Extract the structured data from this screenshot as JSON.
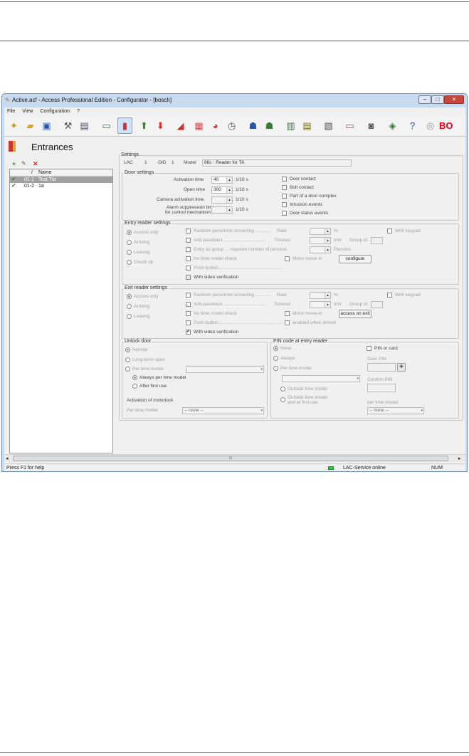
{
  "window": {
    "title": "Active.acf - Access Professional Edition - Configurator - [bosch]",
    "minimize": "–",
    "maximize": "□",
    "close": "✕"
  },
  "menu": [
    "File",
    "View",
    "Configuration",
    "?"
  ],
  "toolbar": {
    "icons": [
      "new-wizard-icon",
      "open-folder-icon",
      "save-icon",
      "device-tools-icon",
      "controllers-icon",
      "card-reader-icon",
      "entrances-icon",
      "import-icon",
      "export-icon",
      "areas-icon",
      "calendar-icon",
      "time-models-icon",
      "day-models-icon",
      "persons-icon",
      "groups-icon",
      "authorizations-icon",
      "authorizations-list-icon",
      "reports-icon",
      "card-icon",
      "video-icon",
      "map-icon",
      "help-icon",
      "bosch-logo"
    ],
    "brand": "BO"
  },
  "page": {
    "title": "Entrances"
  },
  "left_list": {
    "col_sort": "/",
    "col_name": "Name",
    "rows": [
      {
        "id": "01-1",
        "name": "Test Tür",
        "selected": true
      },
      {
        "id": "01-2",
        "name": "1a",
        "selected": false
      }
    ]
  },
  "settings": {
    "label": "Settings",
    "lac_label": "LAC",
    "lac_value": "1",
    "gid_label": "GID",
    "gid_value": "1",
    "model_label": "Model",
    "model_value": "86c - Reader for TA"
  },
  "door_settings": {
    "label": "Door settings",
    "activation_time_label": "Activation time",
    "activation_time_value": "40",
    "activation_time_unit": "1/10 s",
    "open_time_label": "Open time",
    "open_time_value": "300",
    "open_time_unit": "1/10 s",
    "camera_label": "Camera activation time",
    "camera_unit": "1/10 s",
    "alarm_label_1": "Alarm suppression time",
    "alarm_label_2": "for control mechanism",
    "alarm_unit": "1/10 s",
    "checks": [
      "Door contact",
      "Bolt contact",
      "Part of a door-complex",
      "Intrusion events",
      "Door status events"
    ]
  },
  "entry_reader": {
    "label": "Entry reader settings",
    "radios": [
      "Access only",
      "Arriving",
      "Leaving",
      "Check ok"
    ],
    "random": "Random personnel screening ............",
    "rate_label": "Rate",
    "rate_unit": "%",
    "with_keypad": "With keypad",
    "antipassback": "Anti-passback ................................",
    "timeout_label": "Timeout",
    "timeout_unit": "min.",
    "group_id_label": "Group id",
    "entry_group": "Entry as group ... required number of persons",
    "persons_label": "Persons",
    "no_time_model": "No time model check",
    "motor_move_in": "Motor move-in",
    "configure_btn": "configure",
    "push_button": "Push button..................................................",
    "video_verification": "With video verification"
  },
  "exit_reader": {
    "label": "Exit reader settings",
    "radios": [
      "Access only",
      "Arriving",
      "Leaving"
    ],
    "random": "Random personnel screening ............",
    "rate_label": "Rate",
    "rate_unit": "%",
    "with_keypad": "With keypad",
    "antipassback": "Anti-passback ................................",
    "timeout_label": "Timeout",
    "timeout_unit": "min.",
    "group_id_label": "Group id",
    "no_time_model": "No time model check",
    "motor_move_in": "Motor move-in",
    "access_on_exit_btn": "access on exit",
    "push_button": "Push button..................................................",
    "enabled_when_armed": "enabled when armed",
    "video_verification": "With video verification"
  },
  "unlock_door": {
    "label": "Unlock door",
    "normal": "Normal",
    "long_term": "Long-term open",
    "per_time_model": "Per time model",
    "always": "Always per time model",
    "after_first_use": "After first use",
    "motorlock_label": "Activation of motorlock",
    "per_time_model_label": "Per time model",
    "motorlock_value": "-- none --"
  },
  "pin_code": {
    "label": "PIN code at entry reader",
    "none": "None",
    "always": "Always",
    "per_time_model": "Per time model",
    "outside": "Outside time model",
    "outside_first_1": "Outside time model",
    "outside_first_2": "and at first use",
    "pin_or_card": "PIN or card",
    "door_pin": "Door PIN",
    "confirm_pin": "Confirm PIN",
    "per_time_model_lower": "per time model",
    "time_model_value": "-- none --"
  },
  "scrollbar": {
    "left": "◂",
    "right": "▸",
    "grip": "III"
  },
  "statusbar": {
    "help": "Press F1 for help",
    "service": "LAC-Service online",
    "num": "NUM"
  }
}
